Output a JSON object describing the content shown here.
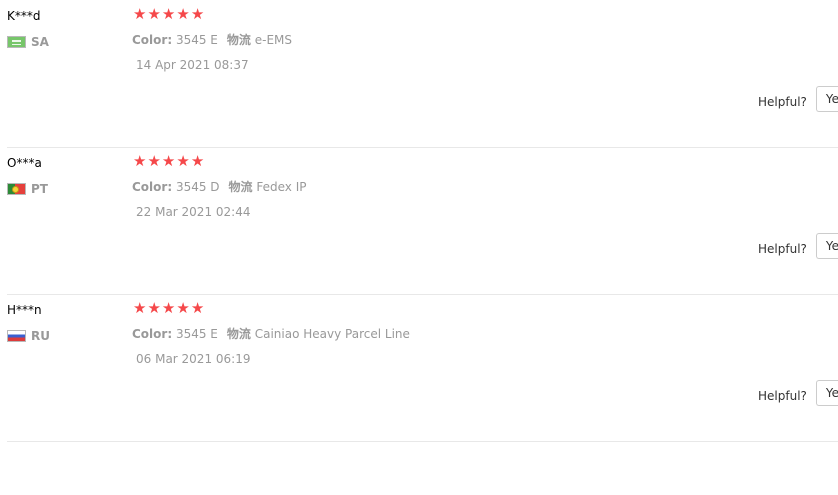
{
  "reviews": [
    {
      "user": "K***d",
      "country": "SA",
      "flag": "saudi-arabia-flag",
      "rating": 5,
      "color_label": "Color:",
      "color_value": "3545 E",
      "shipping_label": "物流",
      "shipping_value": "e-EMS",
      "date": "14 Apr 2021 08:37",
      "helpful_label": "Helpful?",
      "yes_label": "Yes"
    },
    {
      "user": "O***a",
      "country": "PT",
      "flag": "portugal-flag",
      "rating": 5,
      "color_label": "Color:",
      "color_value": "3545 D",
      "shipping_label": "物流",
      "shipping_value": "Fedex IP",
      "date": "22 Mar 2021 02:44",
      "helpful_label": "Helpful?",
      "yes_label": "Yes"
    },
    {
      "user": "H***n",
      "country": "RU",
      "flag": "russia-flag",
      "rating": 5,
      "color_label": "Color:",
      "color_value": "3545 E",
      "shipping_label": "物流",
      "shipping_value": "Cainiao Heavy Parcel Line",
      "date": "06 Mar 2021 06:19",
      "helpful_label": "Helpful?",
      "yes_label": "Yes"
    }
  ],
  "colors": {
    "star": "#f5484a",
    "muted_text": "#999999",
    "divider": "#e8e8e8"
  }
}
